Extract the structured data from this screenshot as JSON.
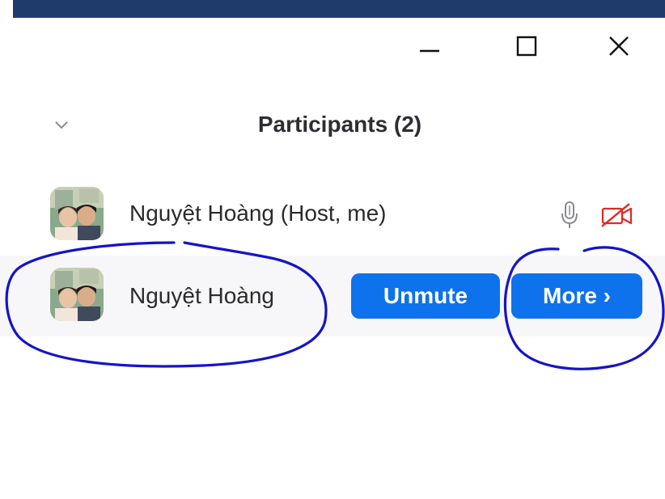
{
  "window_controls": {
    "minimize_icon": "minimize-icon",
    "maximize_icon": "maximize-icon",
    "close_icon": "close-icon"
  },
  "panel": {
    "title": "Participants (2)",
    "collapse_icon": "chevron-down-icon"
  },
  "participants": [
    {
      "name": "Nguyệt Hoàng (Host, me)",
      "mic_icon": "microphone-icon",
      "video_icon": "video-off-icon"
    },
    {
      "name": "Nguyệt Hoàng",
      "unmute_label": "Unmute",
      "more_label": "More ›"
    }
  ],
  "colors": {
    "accent": "#0e72ed",
    "video_off": "#e02828",
    "title_bar": "#1f3b6b",
    "annotation": "#1414c8"
  }
}
